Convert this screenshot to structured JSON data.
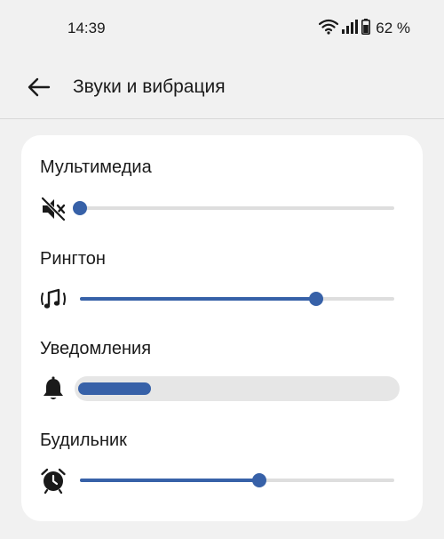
{
  "status_bar": {
    "time": "14:39",
    "battery_text": "62 %",
    "icons": [
      "wifi-icon",
      "signal-icon",
      "battery-icon"
    ]
  },
  "header": {
    "title": "Звуки и вибрация",
    "back_icon": "arrow-left-icon"
  },
  "accent_color": "#3761a8",
  "sliders": [
    {
      "label": "Мультимедиа",
      "icon": "volume-muted-icon",
      "value_percent": 0
    },
    {
      "label": "Рингтон",
      "icon": "ringtone-icon",
      "value_percent": 75
    },
    {
      "label": "Уведомления",
      "icon": "bell-icon",
      "value_percent": 23
    },
    {
      "label": "Будильник",
      "icon": "alarm-clock-icon",
      "value_percent": 57
    }
  ]
}
